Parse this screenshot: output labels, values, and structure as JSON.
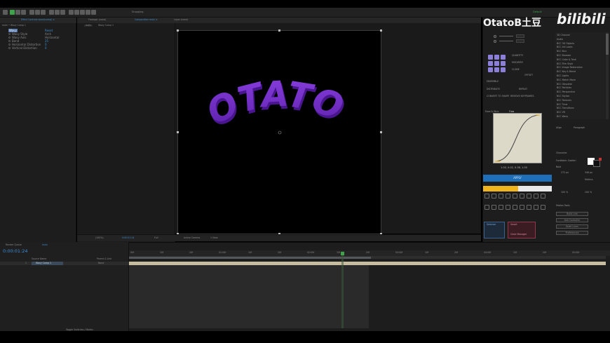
{
  "watermark": {
    "brand": "OtatoB土豆",
    "site": "bilibili"
  },
  "toolbar": {
    "tab_label": "Snapping",
    "workspace": "Default"
  },
  "effect_controls": {
    "tabs": [
      "Effect Controls wave(comp) ≡"
    ],
    "breadcrumb": "main • Wavy Comp 1",
    "rows": [
      {
        "label": "Wavy",
        "value": "Reset"
      },
      {
        "label": "Wavy Style",
        "value": "Arch"
      },
      {
        "label": "Wavy Axis",
        "value": "Horizontal"
      },
      {
        "label": "Bend",
        "value": "25"
      },
      {
        "label": "Horizontal Distortion",
        "value": "0"
      },
      {
        "label": "Vertical Distortion",
        "value": "0"
      }
    ]
  },
  "project": {
    "tab": "Footage: (none)",
    "sub": "main"
  },
  "composition": {
    "tabs": [
      "Composition main ≡",
      "Layer (none)"
    ],
    "flowchart": "Wavy Comp 1",
    "canvas_text": "OTATOB",
    "zoom": "(100%)",
    "timecode_small": "0:00:01:24",
    "quality": "Full",
    "camera": "Active Camera",
    "views": "1 View"
  },
  "right_panel": {
    "effect_list_title": "Effects & Presets",
    "effect_list": [
      "3D Channel",
      "Audio",
      "BCC 3D Objects",
      "BCC Art Looks",
      "BCC Blur",
      "BCC Browser",
      "BCC Color & Tone",
      "BCC Film Style",
      "BCC Image Restoration",
      "BCC Key & Blend",
      "BCC Lights",
      "BCC Match Move",
      "BCC Obsolete",
      "BCC Particles",
      "BCC Perspective",
      "BCC Stylize",
      "BCC Textures",
      "BCC Time",
      "BCC Transitions",
      "BCC VR",
      "BCC Warp"
    ],
    "flow_labels": [
      "QUANTITY",
      "MODIFIER",
      "CLONE",
      "OFFSET",
      "ENSEMBLE",
      "DISTRIBUTE",
      "REPEAT",
      "CONVERT TO SHAPE",
      "REMOVE KEYFRAMES"
    ],
    "curve_tabs": [
      "Ease & Wizz",
      "Flow"
    ],
    "curve_values": "1.00, 0.02, 0.36, 1.00",
    "apply_label": "APPLY",
    "align_tabs": [
      "Align",
      "Paragraph"
    ],
    "character_tab": "Character",
    "font_name": "Fontfabric Gadibri",
    "font_style": "Bold",
    "font_size": "272 px",
    "leading": "346 px",
    "scale_v": "100 %",
    "scale_h": "100 %",
    "tracking": "Metrics",
    "motion_tools": "Motion Tools",
    "select_labels": [
      "Selector",
      "Smart",
      "Sensor"
    ],
    "buttons": [
      "Build Link",
      "Add Controller",
      "Build Lines",
      "Preferences"
    ],
    "extra_button": "Clear Manager"
  },
  "timeline": {
    "tabs": [
      "Render Queue",
      "main"
    ],
    "timecode": "0:00:01:24",
    "columns": [
      "Source Name",
      "Parent & Link"
    ],
    "layer_num": "1",
    "layer_name": "Wavy Comp 1",
    "parent": "None",
    "ruler_ticks": [
      "00f",
      "10f",
      "20f",
      "01:00f",
      "10f",
      "20f",
      "02:00f",
      "10f",
      "20f",
      "03:00f",
      "10f",
      "20f",
      "04:00f",
      "10f",
      "20f",
      "05:00f"
    ],
    "footer": "Toggle Switches / Modes"
  },
  "colors": {
    "accent_blue": "#3d8fd6",
    "text_purple": "#8a3fe0",
    "apply_blue": "#1f6fb8",
    "preset_yellow": "#f0b41f"
  }
}
